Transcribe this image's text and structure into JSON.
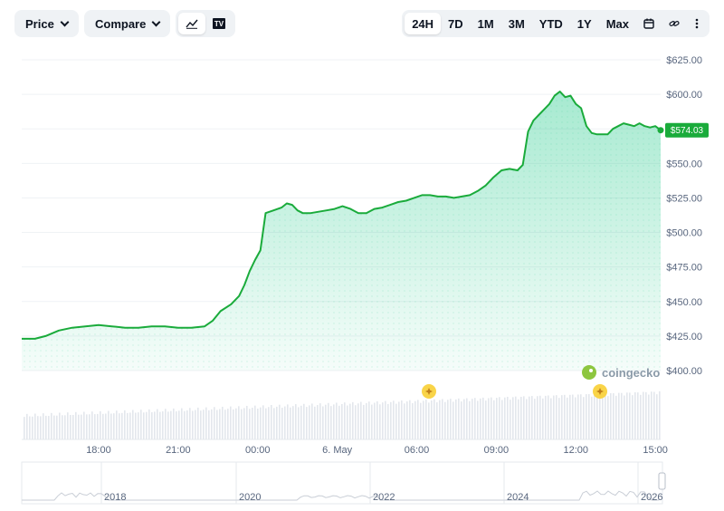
{
  "toolbar": {
    "price_label": "Price",
    "compare_label": "Compare",
    "tv_label": "TV",
    "ranges": [
      "24H",
      "7D",
      "1M",
      "3M",
      "YTD",
      "1Y",
      "Max"
    ],
    "active_range": "24H"
  },
  "brand": {
    "name": "coingecko"
  },
  "colors": {
    "accent": "#16c784",
    "line": "#1aab3b",
    "fill": "#16c784",
    "text": "#58667e",
    "grid": "#eff2f5",
    "volume": "#e3e7ec"
  },
  "chart_data": {
    "type": "area",
    "ylim": [
      400,
      625
    ],
    "y_ticks": [
      "$625.00",
      "$600.00",
      "$575.00",
      "$550.00",
      "$525.00",
      "$500.00",
      "$475.00",
      "$450.00",
      "$425.00",
      "$400.00"
    ],
    "y_tick_values": [
      625,
      600,
      575,
      550,
      525,
      500,
      475,
      450,
      425,
      400
    ],
    "x_range_hours": [
      15.1,
      39.2
    ],
    "x_ticks": [
      {
        "label": "18:00",
        "h": 18
      },
      {
        "label": "21:00",
        "h": 21
      },
      {
        "label": "00:00",
        "h": 24
      },
      {
        "label": "6. May",
        "h": 27
      },
      {
        "label": "06:00",
        "h": 30
      },
      {
        "label": "09:00",
        "h": 33
      },
      {
        "label": "12:00",
        "h": 36
      },
      {
        "label": "15:00",
        "h": 39
      }
    ],
    "series": [
      {
        "values": [
          [
            15.1,
            423
          ],
          [
            15.6,
            423
          ],
          [
            16.0,
            425
          ],
          [
            16.5,
            429
          ],
          [
            17.0,
            431
          ],
          [
            17.5,
            432
          ],
          [
            18.0,
            433
          ],
          [
            18.5,
            432
          ],
          [
            19.0,
            431
          ],
          [
            19.5,
            431
          ],
          [
            20.0,
            432
          ],
          [
            20.5,
            432
          ],
          [
            21.0,
            431
          ],
          [
            21.5,
            431
          ],
          [
            22.0,
            432
          ],
          [
            22.3,
            436
          ],
          [
            22.6,
            443
          ],
          [
            23.0,
            448
          ],
          [
            23.3,
            454
          ],
          [
            23.5,
            462
          ],
          [
            23.7,
            472
          ],
          [
            23.9,
            480
          ],
          [
            24.1,
            487
          ],
          [
            24.3,
            514
          ],
          [
            24.6,
            516
          ],
          [
            24.9,
            518
          ],
          [
            25.1,
            521
          ],
          [
            25.3,
            520
          ],
          [
            25.5,
            516
          ],
          [
            25.7,
            514
          ],
          [
            26.0,
            514
          ],
          [
            26.3,
            515
          ],
          [
            26.6,
            516
          ],
          [
            26.9,
            517
          ],
          [
            27.2,
            519
          ],
          [
            27.5,
            517
          ],
          [
            27.8,
            514
          ],
          [
            28.1,
            514
          ],
          [
            28.4,
            517
          ],
          [
            28.7,
            518
          ],
          [
            29.0,
            520
          ],
          [
            29.3,
            522
          ],
          [
            29.6,
            523
          ],
          [
            29.9,
            525
          ],
          [
            30.2,
            527
          ],
          [
            30.5,
            527
          ],
          [
            30.8,
            526
          ],
          [
            31.1,
            526
          ],
          [
            31.4,
            525
          ],
          [
            31.7,
            526
          ],
          [
            32.0,
            527
          ],
          [
            32.3,
            530
          ],
          [
            32.6,
            534
          ],
          [
            32.9,
            540
          ],
          [
            33.2,
            545
          ],
          [
            33.5,
            546
          ],
          [
            33.8,
            545
          ],
          [
            34.0,
            549
          ],
          [
            34.2,
            573
          ],
          [
            34.4,
            581
          ],
          [
            34.6,
            585
          ],
          [
            34.8,
            589
          ],
          [
            35.0,
            593
          ],
          [
            35.2,
            599
          ],
          [
            35.4,
            602
          ],
          [
            35.6,
            598
          ],
          [
            35.8,
            599
          ],
          [
            36.0,
            593
          ],
          [
            36.2,
            590
          ],
          [
            36.4,
            577
          ],
          [
            36.6,
            572
          ],
          [
            36.8,
            571
          ],
          [
            37.0,
            571
          ],
          [
            37.2,
            571
          ],
          [
            37.4,
            575
          ],
          [
            37.6,
            577
          ],
          [
            37.8,
            579
          ],
          [
            38.0,
            578
          ],
          [
            38.2,
            577
          ],
          [
            38.4,
            579
          ],
          [
            38.6,
            577
          ],
          [
            38.8,
            576
          ],
          [
            39.0,
            577
          ],
          [
            39.2,
            574.03
          ]
        ]
      }
    ],
    "last_price_label": "$574.03",
    "navigator_labels": [
      "2018",
      "2020",
      "2022",
      "2024",
      "2026"
    ]
  }
}
